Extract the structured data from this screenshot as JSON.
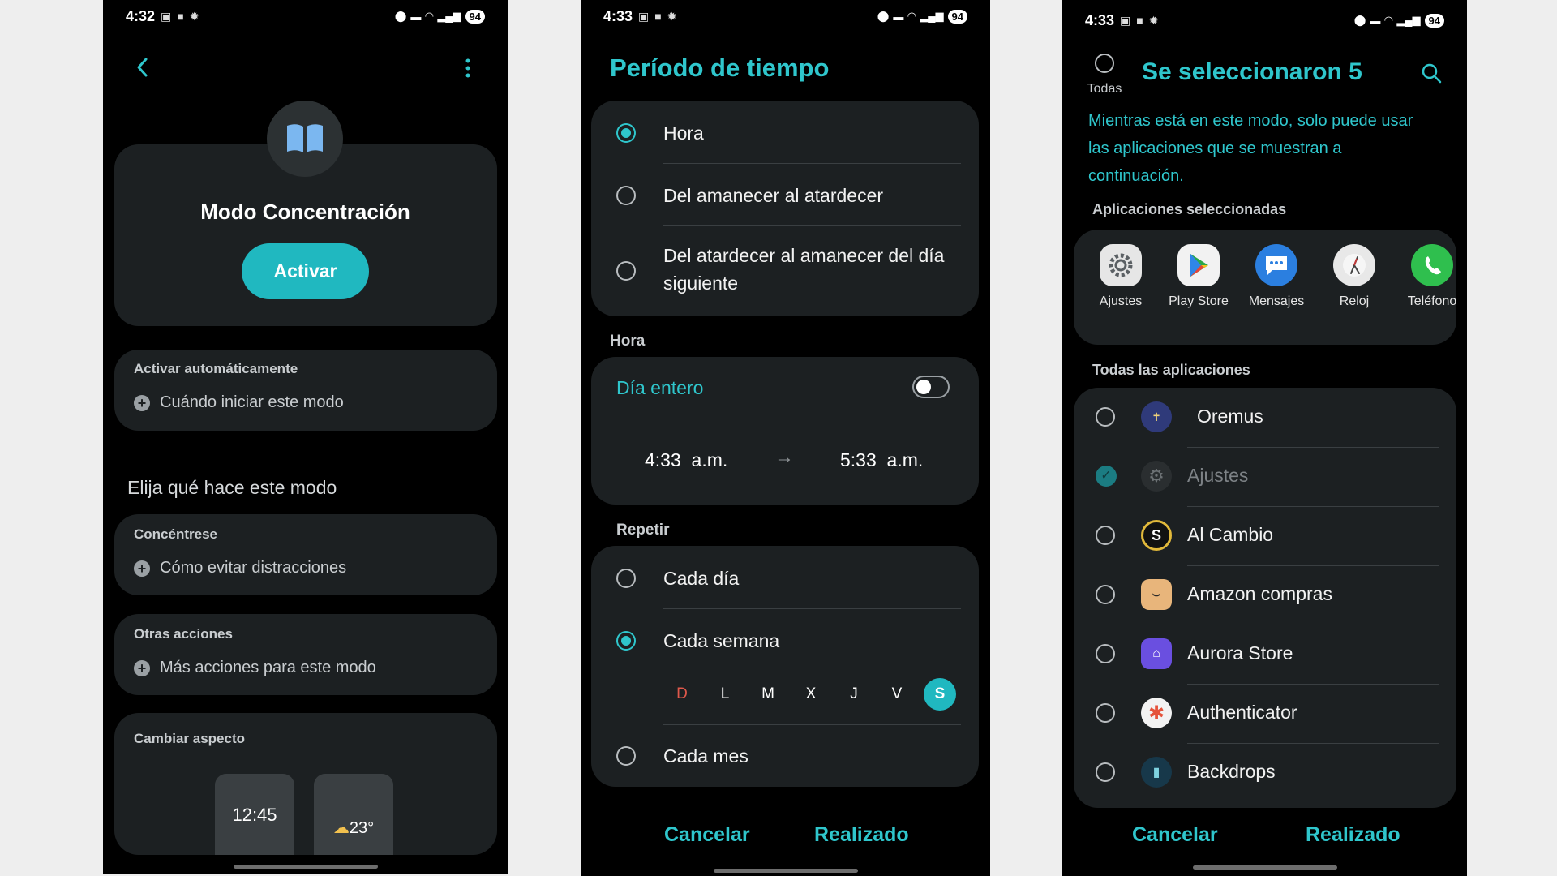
{
  "screen1": {
    "status": {
      "time": "4:32",
      "battery": "94"
    },
    "mode_name": "Modo Concentración",
    "activate_label": "Activar",
    "auto_section": {
      "title": "Activar automáticamente",
      "hint": "Cuándo iniciar este modo"
    },
    "choose_heading": "Elija qué hace este modo",
    "focus_section": {
      "title": "Concéntrese",
      "hint": "Cómo evitar distracciones"
    },
    "other_section": {
      "title": "Otras acciones",
      "hint": "Más acciones para este modo"
    },
    "appearance_section": {
      "title": "Cambiar aspecto",
      "clock_preview": "12:45",
      "weather_preview": "23°"
    }
  },
  "screen2": {
    "status": {
      "time": "4:33",
      "battery": "94"
    },
    "title": "Período de tiempo",
    "period_options": [
      "Hora",
      "Del amanecer al atardecer",
      "Del atardecer al amanecer del día siguiente"
    ],
    "period_selected": 0,
    "time_section_label": "Hora",
    "all_day_label": "Día entero",
    "all_day_enabled": false,
    "start_time": "4:33  a.m.",
    "end_time": "5:33  a.m.",
    "repeat_label": "Repetir",
    "repeat_options": [
      "Cada día",
      "Cada semana",
      "Cada mes"
    ],
    "repeat_selected": 1,
    "weekdays": [
      "D",
      "L",
      "M",
      "X",
      "J",
      "V",
      "S"
    ],
    "weekday_selected": "S",
    "cancel_label": "Cancelar",
    "done_label": "Realizado",
    "accent_color": "#2fc6cc"
  },
  "screen3": {
    "status": {
      "time": "4:33",
      "battery": "94"
    },
    "select_all_label": "Todas",
    "title": "Se seleccionaron 5",
    "description": "Mientras está en este modo, solo puede usar las aplicaciones que se muestran a continuación.",
    "selected_label": "Aplicaciones seleccionadas",
    "selected_apps": [
      "Ajustes",
      "Play Store",
      "Mensajes",
      "Reloj",
      "Teléfono"
    ],
    "all_apps_label": "Todas las aplicaciones",
    "all_apps": [
      {
        "name": "Oremus",
        "checked": false
      },
      {
        "name": "Ajustes",
        "checked": true
      },
      {
        "name": "Al Cambio",
        "checked": false
      },
      {
        "name": "Amazon compras",
        "checked": false
      },
      {
        "name": "Aurora Store",
        "checked": false
      },
      {
        "name": "Authenticator",
        "checked": false
      },
      {
        "name": "Backdrops",
        "checked": false
      }
    ],
    "cancel_label": "Cancelar",
    "done_label": "Realizado"
  }
}
